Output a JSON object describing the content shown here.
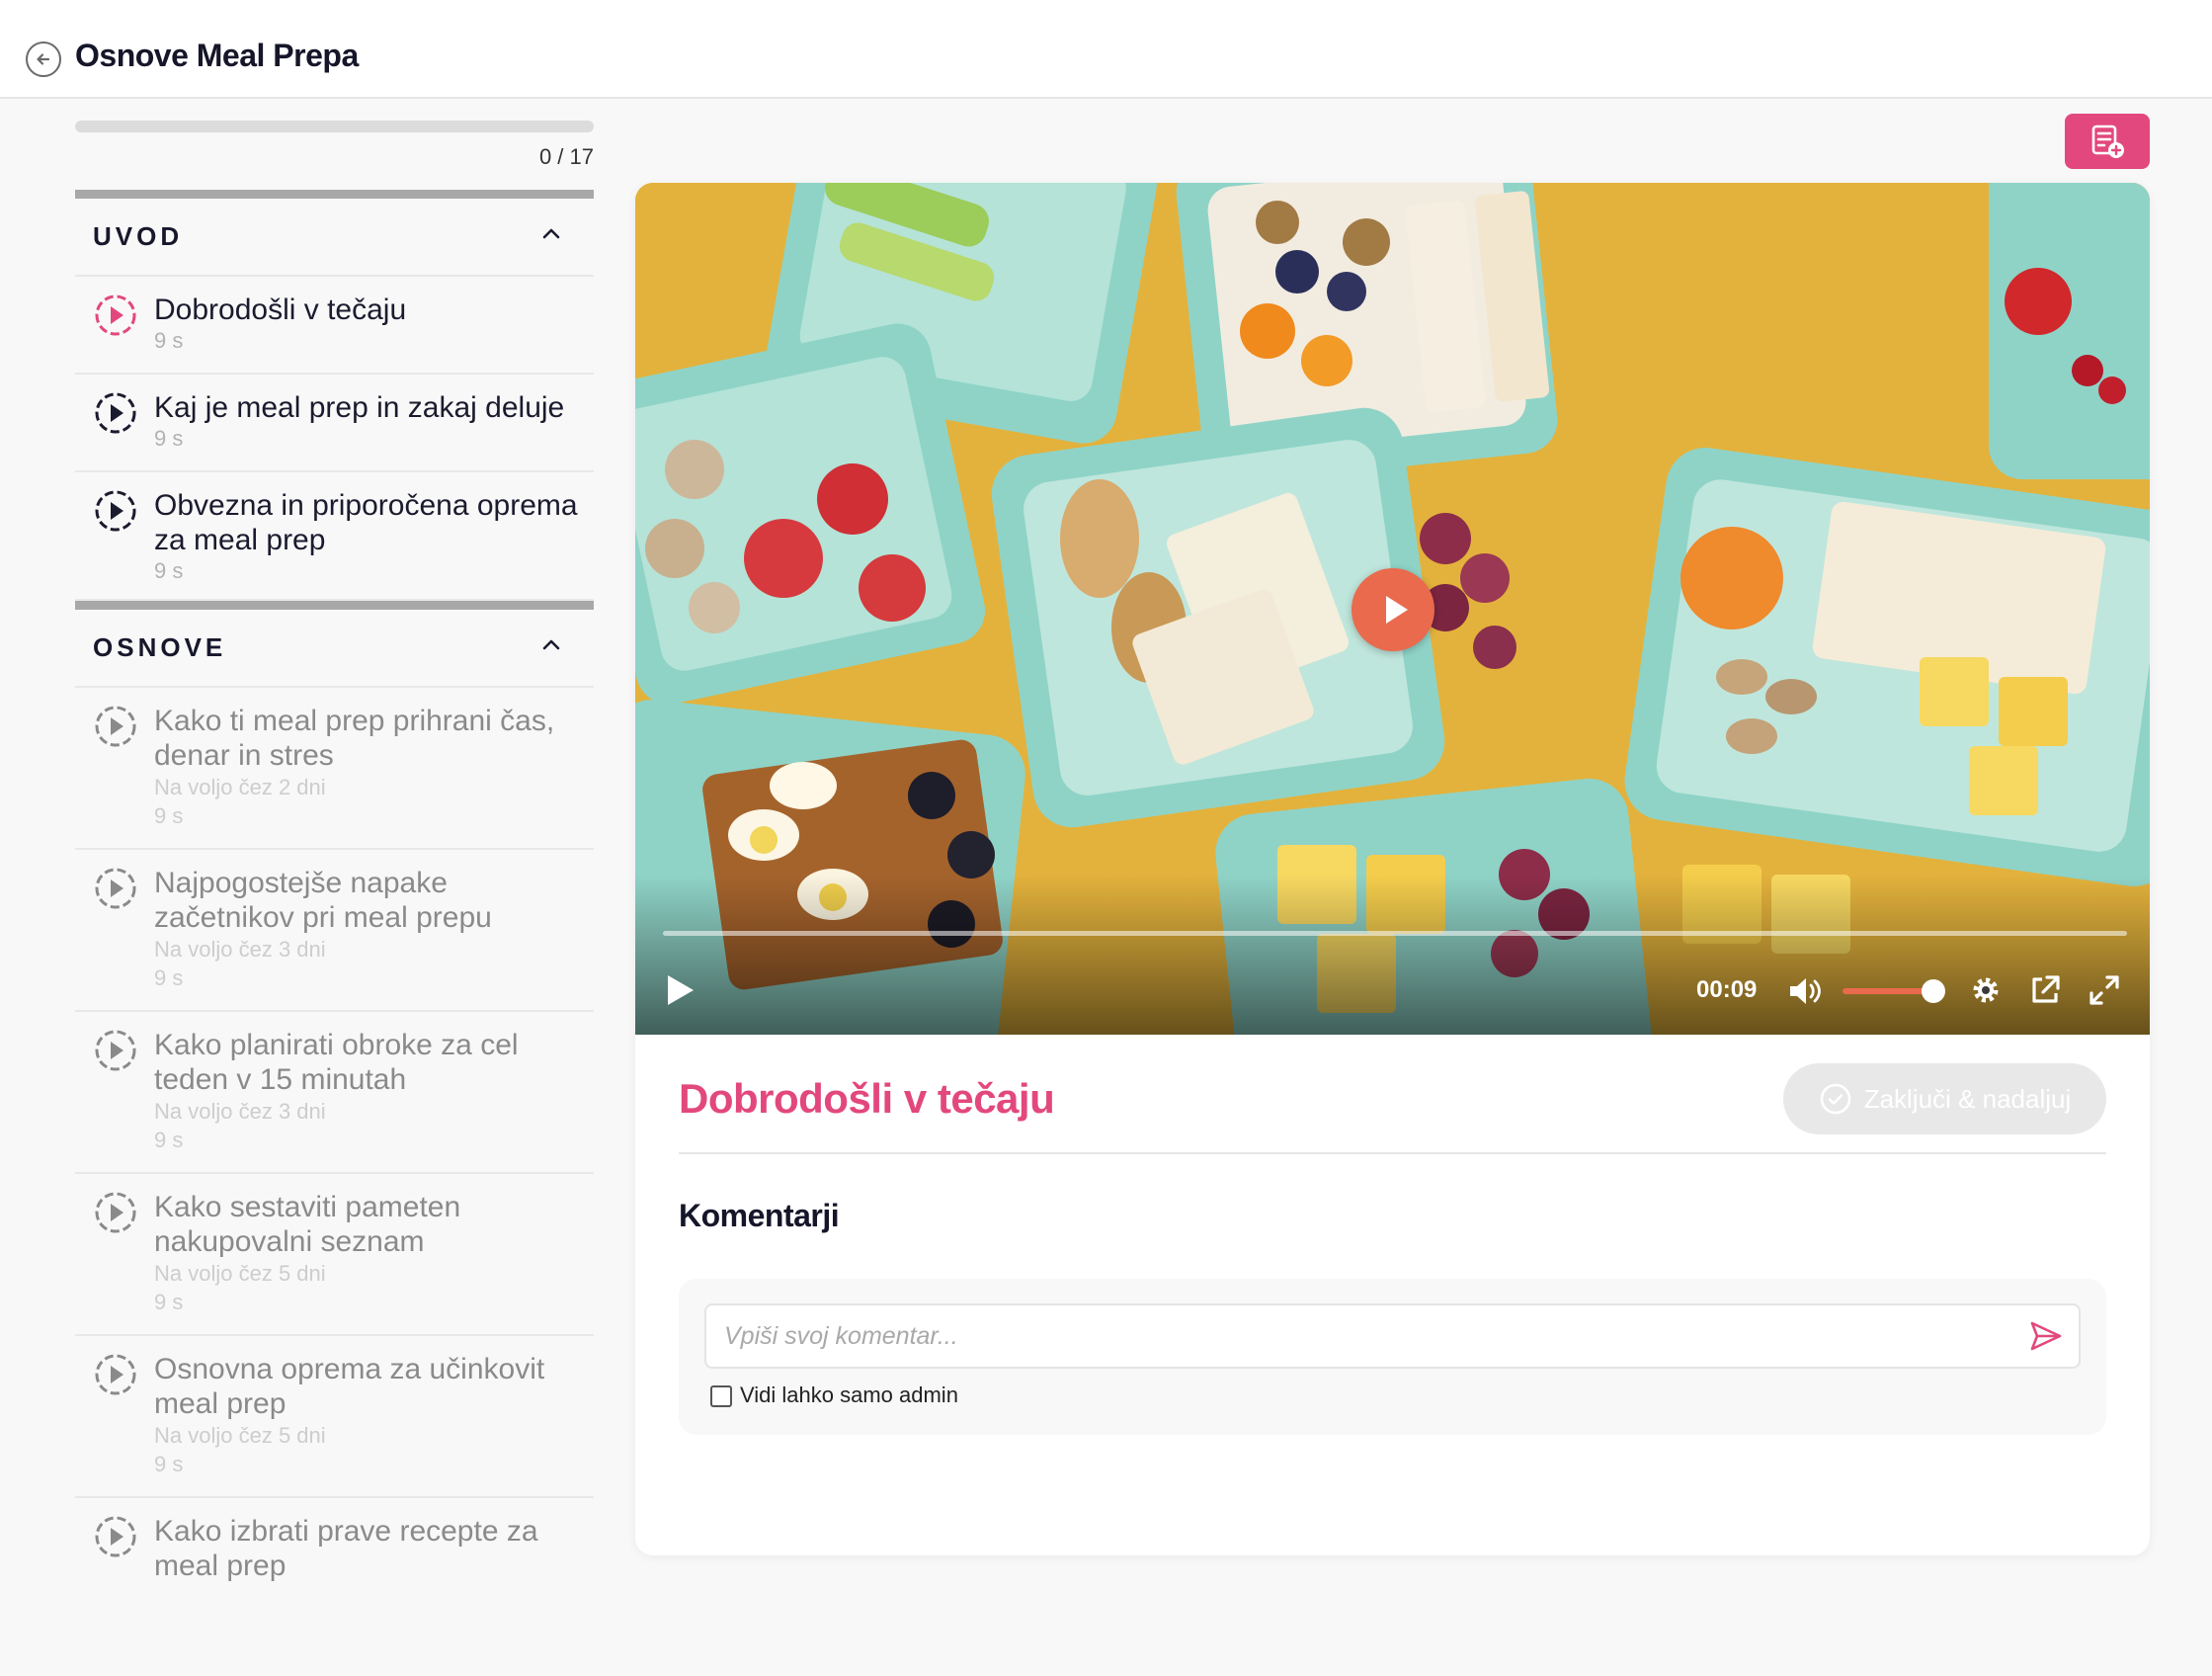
{
  "header": {
    "title": "Osnove Meal Prepa"
  },
  "sidebar": {
    "progress": {
      "completed": 0,
      "total": 17,
      "label": "0 / 17"
    },
    "sections": [
      {
        "title": "UVOD",
        "lessons": [
          {
            "title": "Dobrodošli v tečaju",
            "duration": "9 s",
            "state": "current"
          },
          {
            "title": "Kaj je meal prep in zakaj deluje",
            "duration": "9 s",
            "state": "available"
          },
          {
            "title": "Obvezna in priporočena oprema za meal prep",
            "duration": "9 s",
            "state": "available"
          }
        ]
      },
      {
        "title": "OSNOVE",
        "lessons": [
          {
            "title": "Kako ti meal prep prihrani čas, denar in stres",
            "availability": "Na voljo čez 2 dni",
            "duration": "9 s",
            "state": "locked"
          },
          {
            "title": "Najpogostejše napake začetnikov pri meal prepu",
            "availability": "Na voljo čez 3 dni",
            "duration": "9 s",
            "state": "locked"
          },
          {
            "title": "Kako planirati obroke za cel teden v 15 minutah",
            "availability": "Na voljo čez 3 dni",
            "duration": "9 s",
            "state": "locked"
          },
          {
            "title": "Kako sestaviti pameten nakupovalni seznam",
            "availability": "Na voljo čez 5 dni",
            "duration": "9 s",
            "state": "locked"
          },
          {
            "title": "Osnovna oprema za učinkovit meal prep",
            "availability": "Na voljo čez 5 dni",
            "duration": "9 s",
            "state": "locked"
          },
          {
            "title": "Kako izbrati prave recepte za meal prep",
            "state": "locked"
          }
        ]
      }
    ]
  },
  "player": {
    "time": "00:09",
    "volume": 0.8,
    "colors": {
      "accent": "#ea6a4d"
    }
  },
  "lesson": {
    "title": "Dobrodošli v tečaju",
    "complete_label": "Zaključi & nadaljuj"
  },
  "comments": {
    "title": "Komentarji",
    "placeholder": "Vpiši svoj komentar...",
    "admin_only_label": "Vidi lahko samo admin"
  },
  "theme": {
    "brand": "#e2487d",
    "text": "#16162a"
  },
  "icons": {
    "back": "arrow-left-circle-icon",
    "notes": "note-add-icon",
    "lesson": "play-circle-icon",
    "send": "send-icon"
  }
}
